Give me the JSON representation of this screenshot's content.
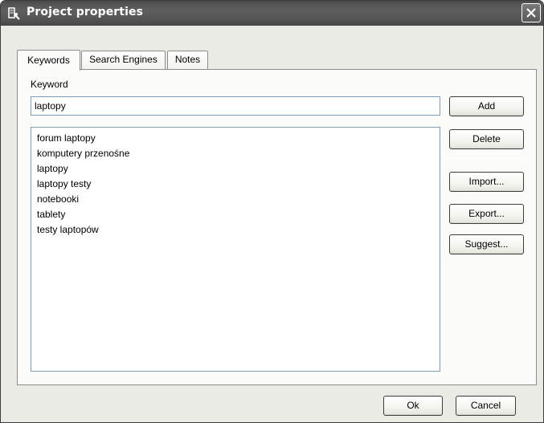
{
  "window": {
    "title": "Project properties"
  },
  "icons": {
    "app": "project-properties-icon",
    "close": "close-icon"
  },
  "tabs": [
    {
      "label": "Keywords",
      "active": true
    },
    {
      "label": "Search Engines",
      "active": false
    },
    {
      "label": "Notes",
      "active": false
    }
  ],
  "keyword": {
    "label": "Keyword",
    "value": "laptopy"
  },
  "keywords_list": [
    "forum laptopy",
    "komputery przenośne",
    "laptopy",
    "laptopy testy",
    "notebooki",
    "tablety",
    "testy laptopów"
  ],
  "buttons": {
    "add": "Add",
    "delete": "Delete",
    "import": "Import...",
    "export": "Export...",
    "suggest": "Suggest...",
    "ok": "Ok",
    "cancel": "Cancel"
  },
  "colors": {
    "titlebar": "#565656",
    "dialog_bg": "#ebebe5",
    "panel_bg": "#fbfbfa",
    "input_border": "#7f9db9"
  }
}
